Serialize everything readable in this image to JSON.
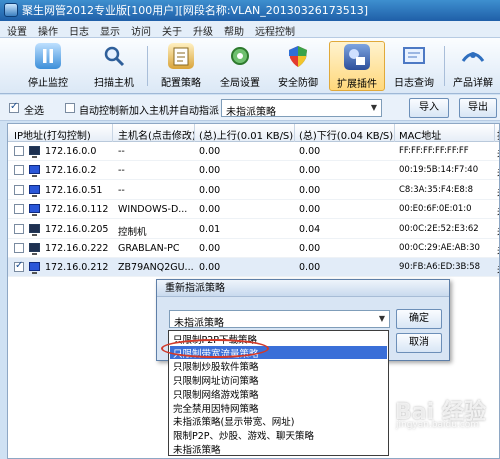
{
  "window": {
    "title": "聚生网管2012专业版[100用户][网段名称:VLAN_20130326173513]"
  },
  "menu": [
    "设置",
    "操作",
    "日志",
    "显示",
    "访问",
    "关于",
    "升级",
    "帮助",
    "远程控制"
  ],
  "toolbar": [
    {
      "label": "停止监控",
      "icon": "pause-icon",
      "color": "#3d8fd9"
    },
    {
      "label": "扫描主机",
      "icon": "scan-hosts-icon",
      "color": "#5d8ec6"
    },
    {
      "label": "配置策略",
      "icon": "config-policy-icon",
      "color": "#d9a43a"
    },
    {
      "label": "全局设置",
      "icon": "global-settings-icon",
      "color": "#4f9f4f"
    },
    {
      "label": "安全防御",
      "icon": "shield-icon",
      "color": "#3aa34a"
    },
    {
      "label": "扩展插件",
      "icon": "plugin-icon",
      "color": "#2d4f9a"
    },
    {
      "label": "日志查询",
      "icon": "log-query-icon",
      "color": "#4d79c4"
    },
    {
      "label": "产品详解",
      "icon": "product-info-icon",
      "color": "#2f6fbf"
    }
  ],
  "options": {
    "select_all": "全选",
    "auto_control": "自动控制新加入主机并自动指派",
    "policy_select": "未指派策略",
    "import": "导入",
    "export": "导出"
  },
  "table": {
    "columns": [
      "IP地址(打勾控制)",
      "主机名(点击修改)",
      "(总)上行(0.01 KB/S)",
      "(总)下行(0.04 KB/S)",
      "MAC地址",
      "指"
    ],
    "rows": [
      {
        "ip": "172.16.0.0",
        "host": "--",
        "up": "0.00",
        "down": "0.00",
        "mac": "FF:FF:FF:FF:FF:FF",
        "extra": "未",
        "checked": false,
        "icon": "dark"
      },
      {
        "ip": "172.16.0.2",
        "host": "--",
        "up": "0.00",
        "down": "0.00",
        "mac": "00:19:5B:14:F7:40",
        "extra": "未",
        "checked": false,
        "icon": "blue"
      },
      {
        "ip": "172.16.0.51",
        "host": "--",
        "up": "0.00",
        "down": "0.00",
        "mac": "C8:3A:35:F4:E8:8",
        "extra": "未",
        "checked": false,
        "icon": "blue"
      },
      {
        "ip": "172.16.0.112",
        "host": "WINDOWS-D...",
        "up": "0.00",
        "down": "0.00",
        "mac": "00:E0:6F:0E:01:0",
        "extra": "未",
        "checked": false,
        "icon": "blue"
      },
      {
        "ip": "172.16.0.205",
        "host": "控制机",
        "up": "0.01",
        "down": "0.04",
        "mac": "00:0C:2E:52:E3:62",
        "extra": "未",
        "checked": false,
        "icon": "dark"
      },
      {
        "ip": "172.16.0.222",
        "host": "GRABLAN-PC",
        "up": "0.00",
        "down": "0.00",
        "mac": "00:0C:29:AE:AB:30",
        "extra": "未",
        "checked": false,
        "icon": "dark"
      },
      {
        "ip": "172.16.0.212",
        "host": "ZB79ANQ2GU...",
        "up": "0.00",
        "down": "0.00",
        "mac": "90:FB:A6:ED:3B:58",
        "extra": "未",
        "checked": true,
        "icon": "blue"
      }
    ]
  },
  "dialog": {
    "title": "重新指派策略",
    "selected": "未指派策略",
    "ok": "确定",
    "cancel": "取消",
    "options": [
      "只限制P2P下载策略",
      "只限制带宽流量策略",
      "只限制炒股软件策略",
      "只限制网址访问策略",
      "只限制网络游戏策略",
      "完全禁用因特网策略",
      "未指派策略(显示带宽、网址)",
      "限制P2P、炒股、游戏、聊天策略",
      "未指派策略"
    ],
    "highlighted_index": 1
  },
  "watermark": {
    "main": "Bai 经验",
    "sub": "jingyan.baidu.com"
  }
}
